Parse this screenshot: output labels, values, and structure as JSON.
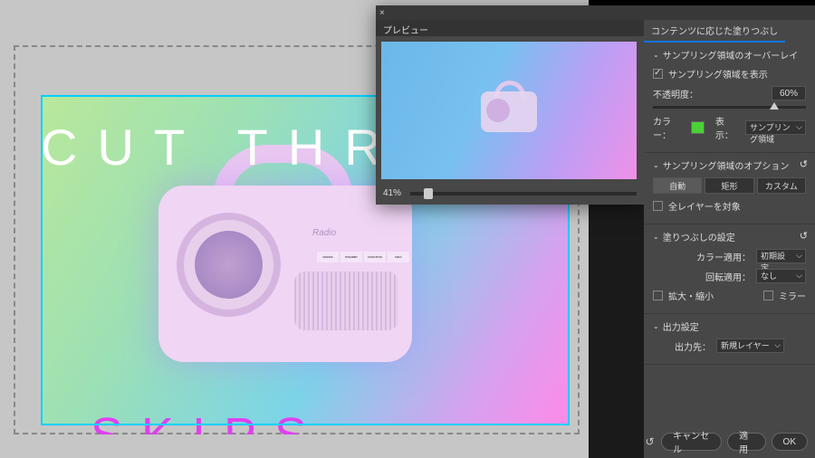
{
  "canvas": {
    "headline": "CUT THROUG",
    "bottom_text": "SKIPS",
    "radio_logo": "Radio",
    "radio_buttons": [
      "ON/OFF",
      "STANDBY",
      "FUNCTION",
      "INFO"
    ]
  },
  "preview": {
    "title": "プレビュー",
    "zoom": "41%"
  },
  "panel": {
    "tab": "コンテンツに応じた塗りつぶし",
    "sec1": {
      "title": "サンプリング領域のオーバーレイ",
      "show_label": "サンプリング領域を表示",
      "opacity_label": "不透明度：",
      "opacity_value": "60%",
      "color_label": "カラー：",
      "indicates_label": "表示：",
      "indicates_value": "サンプリング領域"
    },
    "sec2": {
      "title": "サンプリング領域のオプション",
      "auto": "自動",
      "rect": "矩形",
      "custom": "カスタム",
      "all_layers": "全レイヤーを対象"
    },
    "sec3": {
      "title": "塗りつぶしの設定",
      "color_adapt_label": "カラー適用：",
      "color_adapt_value": "初期設定",
      "rotation_label": "回転適用：",
      "rotation_value": "なし",
      "scale": "拡大・縮小",
      "mirror": "ミラー"
    },
    "sec4": {
      "title": "出力設定",
      "output_to_label": "出力先：",
      "output_to_value": "新規レイヤー"
    },
    "footer": {
      "cancel": "キャンセル",
      "apply": "適用",
      "ok": "OK"
    }
  }
}
